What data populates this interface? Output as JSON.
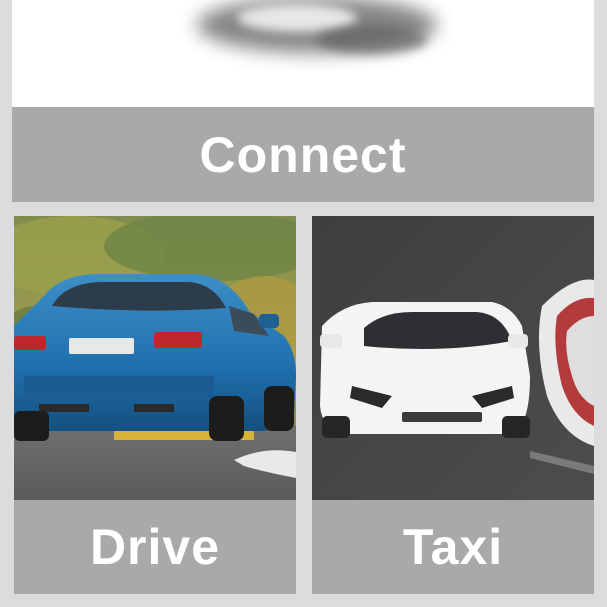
{
  "cards": {
    "connect": {
      "label": "Connect",
      "image": "phone-device-icon"
    },
    "drive": {
      "label": "Drive",
      "image": "blue-car-rear-photo"
    },
    "taxi": {
      "label": "Taxi",
      "image": "white-supercar-on-track-photo"
    }
  },
  "colors": {
    "label_bar": "#a9a8ab",
    "label_text": "#ffffff",
    "background": "#dcdcde"
  }
}
